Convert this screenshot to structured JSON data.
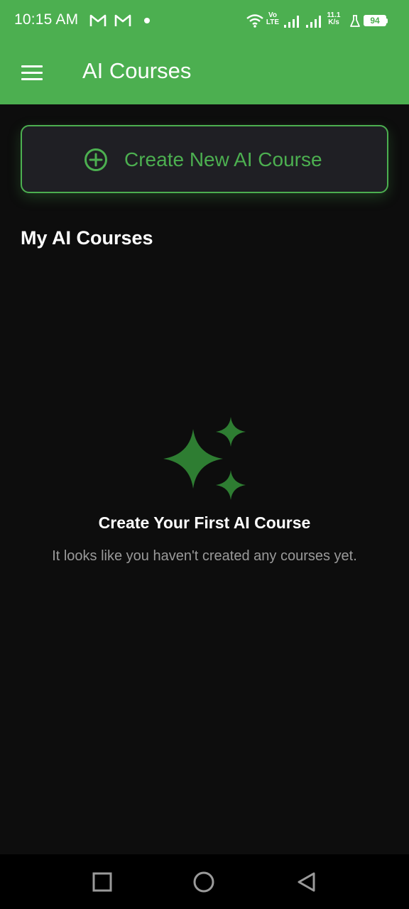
{
  "status_bar": {
    "time": "10:15 AM",
    "volte": "Vo LTE",
    "speed": "11.1 K/s",
    "battery": "94"
  },
  "app_bar": {
    "title": "AI Courses",
    "menu_icon": "menu-icon"
  },
  "create_button": {
    "label": "Create New AI Course",
    "icon": "plus-circle-icon"
  },
  "section": {
    "title": "My AI Courses"
  },
  "empty_state": {
    "icon": "sparkles-icon",
    "title": "Create Your First AI Course",
    "subtitle": "It looks like you haven't created any courses yet."
  },
  "nav": {
    "recent": "square-icon",
    "home": "circle-icon",
    "back": "triangle-back-icon"
  },
  "colors": {
    "accent": "#4caf50",
    "background": "#0d0d0d",
    "button_bg": "#1f1f24",
    "sparkle": "#2e7d32"
  }
}
